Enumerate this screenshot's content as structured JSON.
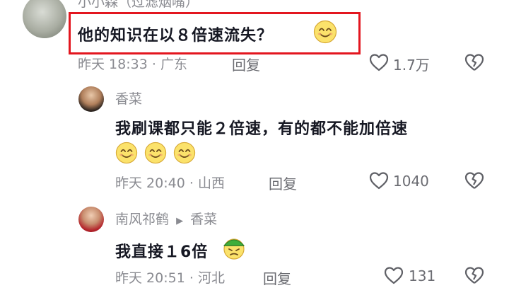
{
  "comments": [
    {
      "username": "小小森（过滤烟嘴）",
      "text": "他的知识在以８倍速流失？",
      "time": "昨天 18:33",
      "location": "广东",
      "reply_label": "回复",
      "likes": "1.7万",
      "highlighted": true,
      "emoji": "smiling-face"
    },
    {
      "username": "香菜",
      "text": "我刷课都只能２倍速，有的都不能加倍速",
      "time": "昨天 20:40",
      "location": "山西",
      "reply_label": "回复",
      "likes": "1040",
      "emoji": "smiling-face x3"
    },
    {
      "username": "南风祁鹤",
      "reply_to": "香菜",
      "text": "我直接１6倍",
      "time": "昨天 20:51",
      "location": "河北",
      "reply_label": "回复",
      "likes": "131",
      "emoji": "green-hat-face"
    }
  ],
  "colors": {
    "highlight": "#e3161f",
    "text": "#161823",
    "muted": "#8a8b91"
  }
}
